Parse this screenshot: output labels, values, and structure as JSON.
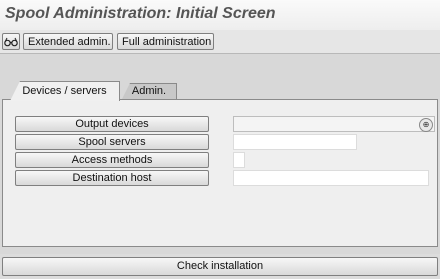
{
  "window": {
    "title": "Spool Administration: Initial Screen"
  },
  "toolbar": {
    "icon": "glasses-icon",
    "extended_admin_label": "Extended admin.",
    "full_admin_label": "Full administration"
  },
  "tabs": [
    {
      "label": "Devices / servers",
      "active": true
    },
    {
      "label": "Admin.",
      "active": false
    }
  ],
  "rows": [
    {
      "label": "Output devices",
      "value": ""
    },
    {
      "label": "Spool servers",
      "value": ""
    },
    {
      "label": "Access methods",
      "value": ""
    },
    {
      "label": "Destination host",
      "value": ""
    }
  ],
  "footer": {
    "check_installation_label": "Check installation"
  }
}
